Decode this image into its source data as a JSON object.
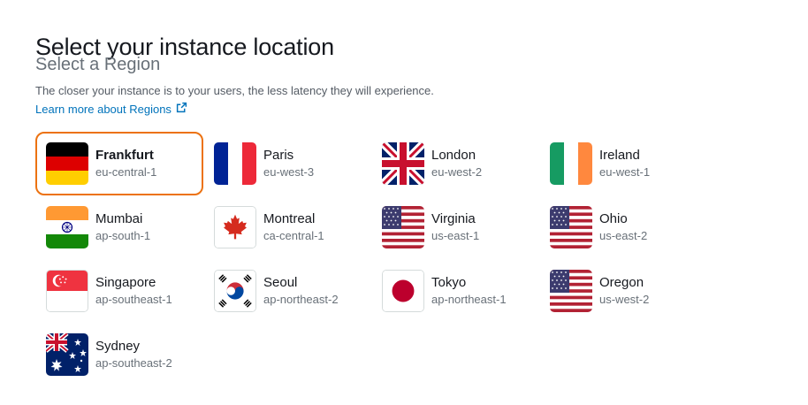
{
  "header": {
    "title": "Select your instance location",
    "subtitle": "Select a Region",
    "description": "The closer your instance is to your users, the less latency they will experience.",
    "learn_more": "Learn more about Regions"
  },
  "selected_region": "eu-central-1",
  "accent_color": "#ec7211",
  "link_color": "#0073bb",
  "regions": [
    {
      "city": "Frankfurt",
      "code": "eu-central-1",
      "flag": "germany-flag-icon",
      "selected": true
    },
    {
      "city": "Paris",
      "code": "eu-west-3",
      "flag": "france-flag-icon",
      "selected": false
    },
    {
      "city": "London",
      "code": "eu-west-2",
      "flag": "uk-flag-icon",
      "selected": false
    },
    {
      "city": "Ireland",
      "code": "eu-west-1",
      "flag": "ireland-flag-icon",
      "selected": false
    },
    {
      "city": "Mumbai",
      "code": "ap-south-1",
      "flag": "india-flag-icon",
      "selected": false
    },
    {
      "city": "Montreal",
      "code": "ca-central-1",
      "flag": "canada-flag-icon",
      "selected": false
    },
    {
      "city": "Virginia",
      "code": "us-east-1",
      "flag": "us-flag-icon",
      "selected": false
    },
    {
      "city": "Ohio",
      "code": "us-east-2",
      "flag": "us-flag-icon",
      "selected": false
    },
    {
      "city": "Singapore",
      "code": "ap-southeast-1",
      "flag": "singapore-flag-icon",
      "selected": false
    },
    {
      "city": "Seoul",
      "code": "ap-northeast-2",
      "flag": "south-korea-flag-icon",
      "selected": false
    },
    {
      "city": "Tokyo",
      "code": "ap-northeast-1",
      "flag": "japan-flag-icon",
      "selected": false
    },
    {
      "city": "Oregon",
      "code": "us-west-2",
      "flag": "us-flag-icon",
      "selected": false
    },
    {
      "city": "Sydney",
      "code": "ap-southeast-2",
      "flag": "australia-flag-icon",
      "selected": false
    }
  ]
}
